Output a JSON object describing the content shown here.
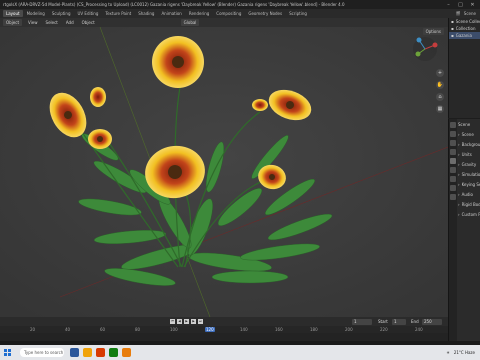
{
  "window": {
    "title": "rtgolsX (ARA-DRVZ-5d Model-Plants) (CS_Processing to Upload) (LC0012) Gazania rigens 'Daybreak Yellow' (Blender) Gazania rigens 'Daybreak Yellow'.blend] - Blender 4.0",
    "controls": [
      "–",
      "□",
      "✕"
    ]
  },
  "workspaces": {
    "tabs": [
      "Layout",
      "Modeling",
      "Sculpting",
      "UV Editing",
      "Texture Paint",
      "Shading",
      "Animation",
      "Rendering",
      "Compositing",
      "Geometry Nodes",
      "Scripting"
    ],
    "active_index": 0,
    "scene_label": "Scene"
  },
  "viewport_header": {
    "mode": "Object",
    "view_label": "View",
    "select_label": "Select",
    "add_label": "Add",
    "object_label": "Object",
    "transform": "Global",
    "options_label": "Options"
  },
  "navigation_buttons": [
    "+",
    "✋",
    "⌂",
    "▦"
  ],
  "outliner": {
    "rows": [
      {
        "label": "Scene Collection",
        "selected": false
      },
      {
        "label": "Collection",
        "selected": false
      },
      {
        "label": "Gazania",
        "selected": true
      }
    ]
  },
  "properties": {
    "header": "Scene",
    "rows": [
      "Scene",
      "Background",
      "Units",
      "Gravity",
      "Simulation",
      "Keying Sets",
      "Audio",
      "Rigid Body",
      "Custom Props"
    ]
  },
  "timeline": {
    "start_label": "Start",
    "start": "1",
    "end_label": "End",
    "end": "250",
    "current_frame": "1",
    "ruler_ticks": [
      "20",
      "40",
      "60",
      "80",
      "100",
      "120",
      "140",
      "160",
      "180",
      "200",
      "220",
      "240"
    ],
    "current_tick": "120"
  },
  "taskbar": {
    "search_placeholder": "Type here to search",
    "weather": "21°C  Haze",
    "app_colors": [
      "#2b579a",
      "#f0a30a",
      "#d83b01",
      "#107c10",
      "#e87d0d"
    ]
  },
  "colors": {
    "viewport_bg": "#3a3a3a",
    "petal_yellow": "#f2c022",
    "petal_red": "#b73a12",
    "leaf_green": "#3d8a3a"
  }
}
